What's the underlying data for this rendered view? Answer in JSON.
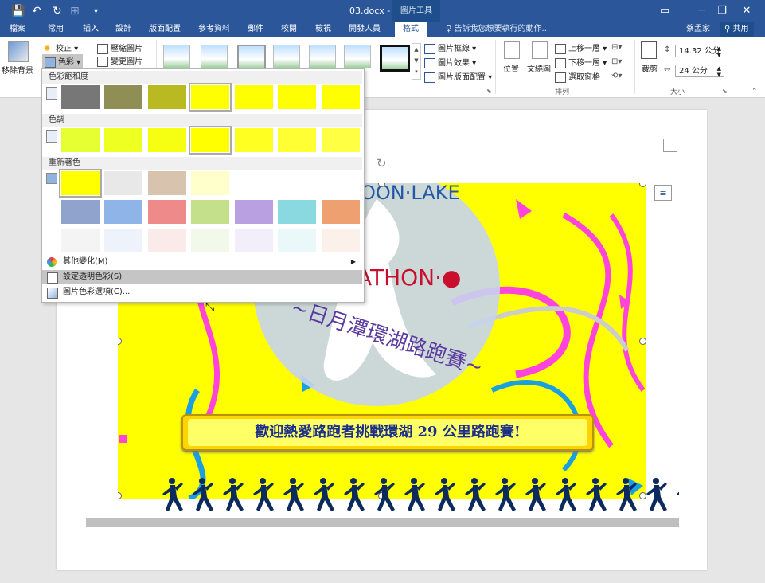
{
  "window": {
    "title": "03.docx - Word",
    "tools_title": "圖片工具",
    "minimize": "─",
    "restore": "❐",
    "close": "✕",
    "ribbon_display": "▭"
  },
  "tabs": [
    {
      "label": "檔案"
    },
    {
      "label": "常用"
    },
    {
      "label": "插入"
    },
    {
      "label": "設計"
    },
    {
      "label": "版面配置"
    },
    {
      "label": "參考資料"
    },
    {
      "label": "郵件"
    },
    {
      "label": "校閱"
    },
    {
      "label": "檢視"
    },
    {
      "label": "開發人員"
    },
    {
      "label": "格式"
    }
  ],
  "tell_me": "告訴我您想要執行的動作...",
  "user": "蔡孟家",
  "share": "共用",
  "ribbon": {
    "remove_bg": "移除背景",
    "corrections": "校正",
    "color": "色彩",
    "compress": "壓縮圖片",
    "change": "變更圖片",
    "picture_border": "圖片框線",
    "picture_effects": "圖片效果",
    "picture_layout": "圖片版面配置",
    "position": "位置",
    "wrap_text": "文繞圖",
    "bring_forward": "上移一層",
    "send_backward": "下移一層",
    "selection_pane": "選取窗格",
    "arrange_group": "排列",
    "crop": "裁剪",
    "height": "14.32 公分",
    "width": "24 公分",
    "size_group": "大小"
  },
  "menu": {
    "saturation": "色彩飽和度",
    "tone": "色調",
    "recolor": "重新著色",
    "more_variations": "其他變化(M)",
    "set_transparent": "設定透明色彩(S)",
    "color_options": "圖片色彩選項(C)..."
  },
  "document": {
    "logo_arc_top": "OON·LAKE",
    "logo_arc_mid": "ATHON·●",
    "logo_arc_cn": "~日月潭環湖路跑賽~",
    "banner": "歡迎熱愛路跑者挑戰環湖 29 公里路跑賽!"
  }
}
